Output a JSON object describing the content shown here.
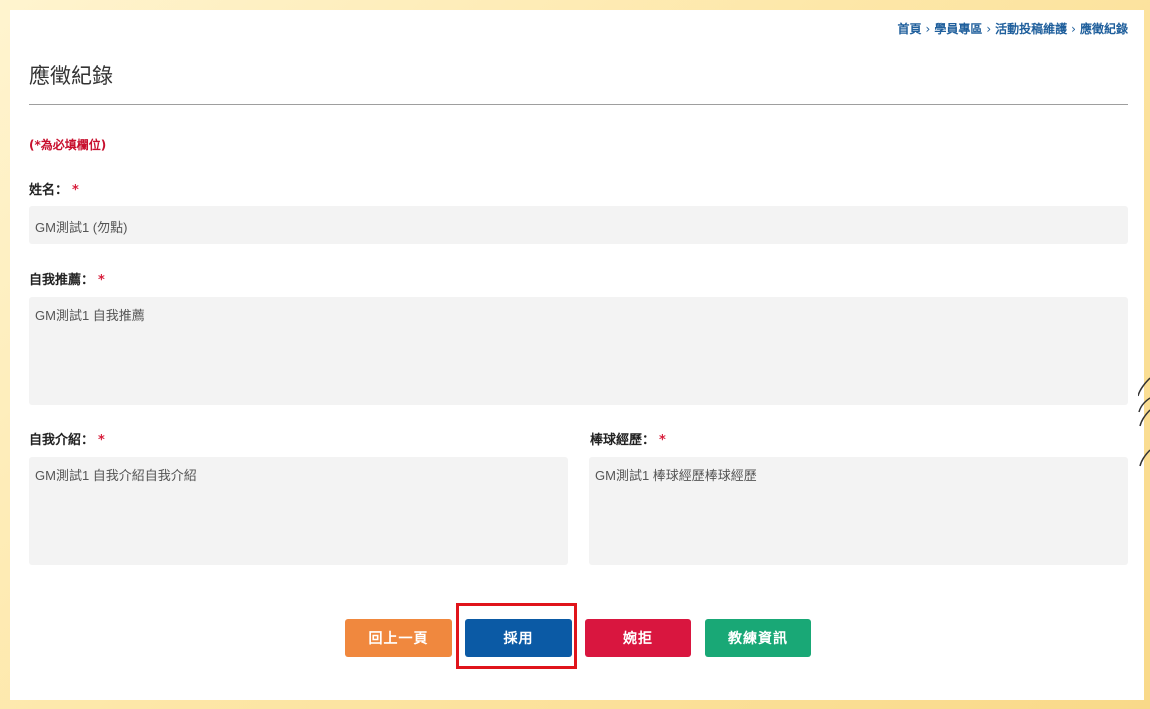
{
  "breadcrumb": [
    "首頁",
    "學員專區",
    "活動投稿維護",
    "應徵紀錄"
  ],
  "breadcrumb_separator": "›",
  "page_title": "應徵紀錄",
  "required_note": "(*為必填欄位)",
  "required_marker": "*",
  "fields": {
    "name": {
      "label": "姓名：",
      "value": "GM測試1 (勿點)"
    },
    "self_recommend": {
      "label": "自我推薦：",
      "value": "GM測試1 自我推薦"
    },
    "self_intro": {
      "label": "自我介紹：",
      "value": "GM測試1 自我介紹自我介紹"
    },
    "baseball_exp": {
      "label": "棒球經歷：",
      "value": "GM測試1 棒球經歷棒球經歷"
    }
  },
  "buttons": {
    "back": {
      "label": "回上一頁",
      "color": "#f0883e"
    },
    "accept": {
      "label": "採用",
      "color": "#0b5aa5"
    },
    "decline": {
      "label": "婉拒",
      "color": "#d9163f"
    },
    "coach_info": {
      "label": "教練資訊",
      "color": "#19a876"
    }
  },
  "highlight_color": "#e0141b"
}
